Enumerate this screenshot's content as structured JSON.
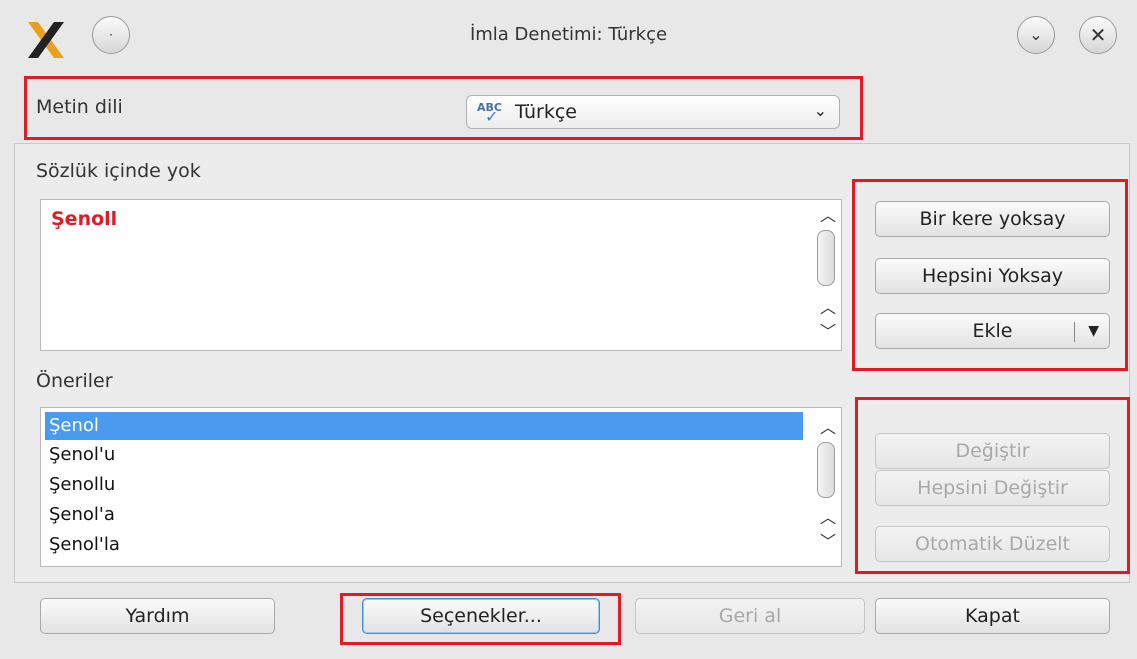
{
  "window": {
    "title": "İmla Denetimi: Türkçe"
  },
  "language": {
    "label": "Metin dili",
    "value": "Türkçe",
    "icon": "spellcheck-abc-icon"
  },
  "not_in_dictionary": {
    "label": "Sözlük içinde yok",
    "word": "Şenoll"
  },
  "suggestions": {
    "label": "Öneriler",
    "items": [
      "Şenol",
      "Şenol'u",
      "Şenollu",
      "Şenol'a",
      "Şenol'la"
    ],
    "selected_index": 0
  },
  "actions": {
    "ignore_once": "Bir kere yoksay",
    "ignore_all": "Hepsini Yoksay",
    "add": "Ekle",
    "change": "Değiştir",
    "change_all": "Hepsini Değiştir",
    "autocorrect": "Otomatik Düzelt"
  },
  "footer": {
    "help": "Yardım",
    "options": "Seçenekler...",
    "undo": "Geri al",
    "close": "Kapat"
  },
  "colors": {
    "highlight": "#e01b24",
    "selection": "#4a9bf0",
    "error_text": "#e01b24"
  }
}
